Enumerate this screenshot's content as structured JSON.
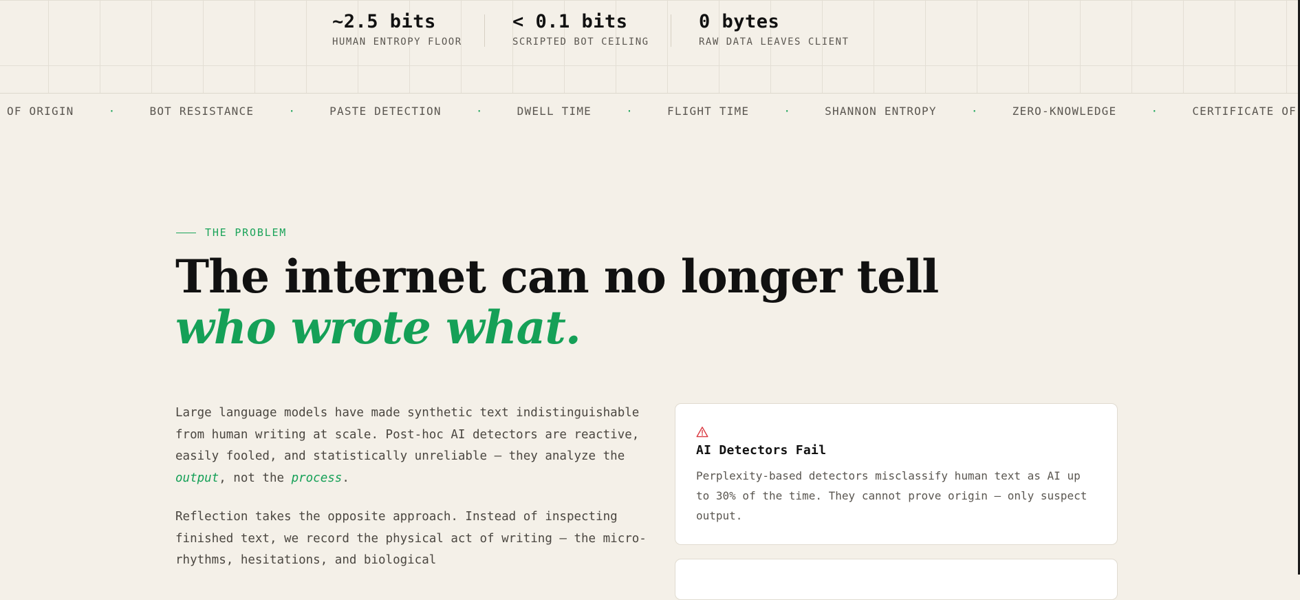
{
  "stats": [
    {
      "value": "~2.5 bits",
      "label": "HUMAN ENTROPY FLOOR"
    },
    {
      "value": "< 0.1 bits",
      "label": "SCRIPTED BOT CEILING"
    },
    {
      "value": "0 bytes",
      "label": "RAW DATA LEAVES CLIENT"
    }
  ],
  "ticker": {
    "separator": "·",
    "items": [
      "CERTIFICATE OF ORIGIN",
      "BOT RESISTANCE",
      "PASTE DETECTION",
      "DWELL TIME",
      "FLIGHT TIME",
      "SHANNON ENTROPY",
      "ZERO-KNOWLEDGE",
      "CERTIFICATE OF ORIGIN"
    ]
  },
  "problem": {
    "eyebrow": "THE PROBLEM",
    "headline_line1": "The internet can no longer tell",
    "headline_line2": "who wrote what.",
    "p1_before": "Large language models have made synthetic text indistinguishable from human writing at scale. Post-hoc AI detectors are reactive, easily fooled, and statistically unreliable — they analyze the ",
    "p1_em1": "output",
    "p1_mid": ", not the ",
    "p1_em2": "process",
    "p1_after": ".",
    "p2": "Reflection takes the opposite approach. Instead of inspecting finished text, we record the physical act of writing — the micro-rhythms, hesitations, and biological"
  },
  "cards": [
    {
      "icon": "warning-icon",
      "title": "AI Detectors Fail",
      "description": "Perplexity-based detectors misclassify human text as AI up to 30% of the time. They cannot prove origin — only suspect output."
    }
  ],
  "colors": {
    "accent": "#1aa359",
    "background": "#f4f0e8",
    "warning": "#d9363e"
  }
}
